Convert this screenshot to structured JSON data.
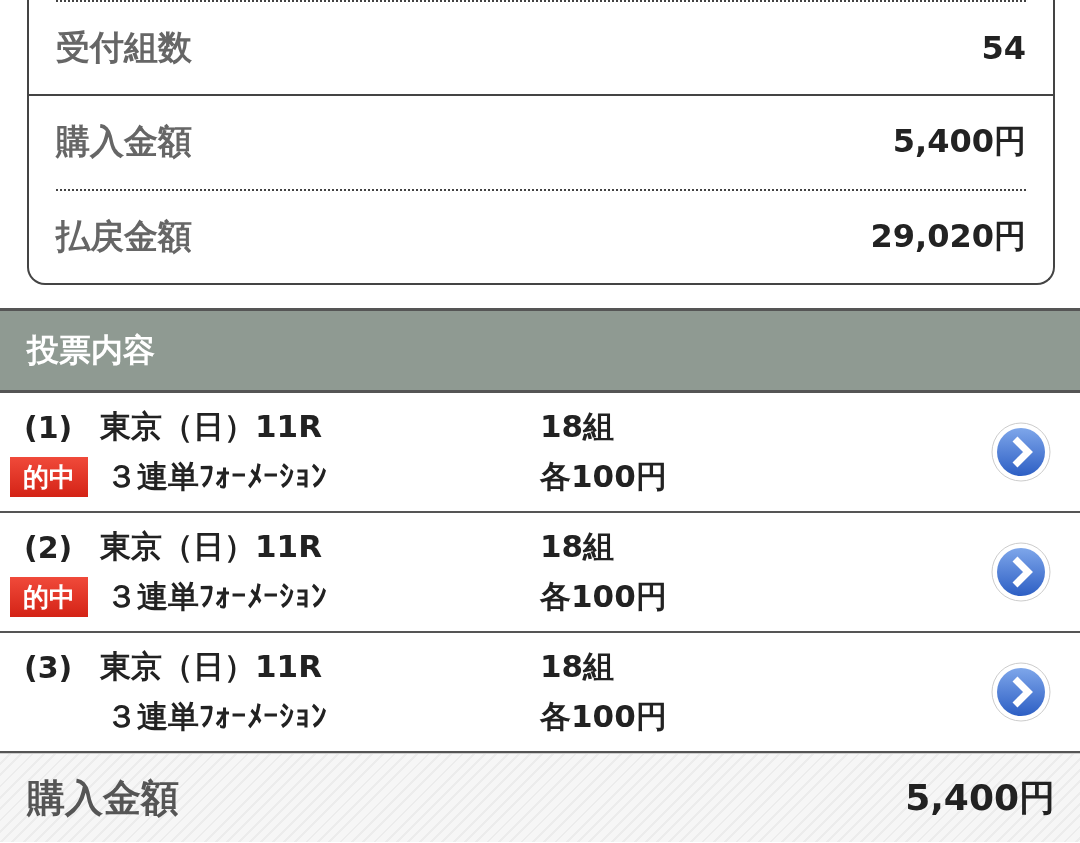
{
  "summary": [
    {
      "label": "受付組数",
      "value": "54"
    },
    {
      "label": "購入金額",
      "value": "5,400円"
    },
    {
      "label": "払戻金額",
      "value": "29,020円"
    }
  ],
  "section_title": "投票内容",
  "bets": [
    {
      "number": "(1)",
      "badge": "的中",
      "race": "東京（日）11R",
      "type": "３連単ﾌｫｰﾒｰｼｮﾝ",
      "combos": "18組",
      "stake": "各100円"
    },
    {
      "number": "(2)",
      "badge": "的中",
      "race": "東京（日）11R",
      "type": "３連単ﾌｫｰﾒｰｼｮﾝ",
      "combos": "18組",
      "stake": "各100円"
    },
    {
      "number": "(3)",
      "race": "東京（日）11R",
      "type": "３連単ﾌｫｰﾒｰｼｮﾝ",
      "combos": "18組",
      "stake": "各100円"
    }
  ],
  "total": {
    "label": "購入金額",
    "value": "5,400円"
  }
}
